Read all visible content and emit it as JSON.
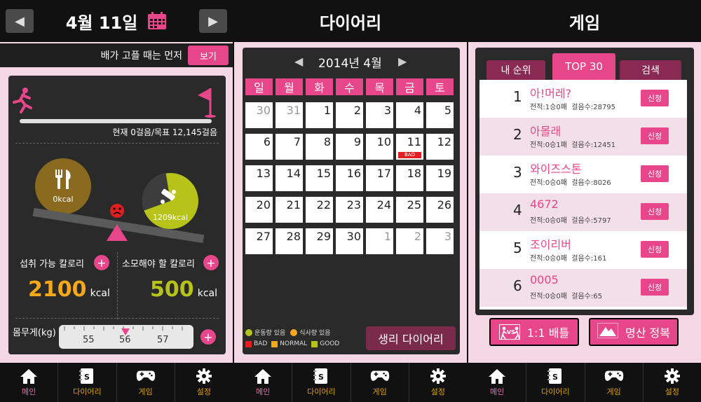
{
  "colors": {
    "accent": "#e8468b",
    "yellow": "#f4a81a",
    "lime": "#b7c318",
    "brown": "#8a6a1e"
  },
  "nav": [
    {
      "label": "메인",
      "icon": "home-icon"
    },
    {
      "label": "다이어리",
      "icon": "diary-icon"
    },
    {
      "label": "게임",
      "icon": "gamepad-icon"
    },
    {
      "label": "설정",
      "icon": "gear-icon"
    }
  ],
  "main": {
    "date": "4월 11일",
    "banner_text": "배가 고플 때는 먼저",
    "banner_button": "보기",
    "steps_text": "현재 0걸음/목표 12,145걸음",
    "intake_kcal": "0kcal",
    "burn_kcal": "1209kcal",
    "burn_fraction": 0.72,
    "intake_label": "섭취 가능 칼로리",
    "burn_label": "소모해야 할 칼로리",
    "intake_value": "2100",
    "burn_value": "500",
    "unit": "kcal",
    "weight_label": "몸무게(kg)",
    "weight_ticks": [
      "55",
      "56",
      "57"
    ]
  },
  "diary": {
    "title": "다이어리",
    "month": "2014년 4월",
    "weekdays": [
      "일",
      "월",
      "화",
      "수",
      "목",
      "금",
      "토"
    ],
    "days": [
      [
        "30",
        "31",
        "1",
        "2",
        "3",
        "4",
        "5"
      ],
      [
        "6",
        "7",
        "8",
        "9",
        "10",
        "11",
        "12"
      ],
      [
        "13",
        "14",
        "15",
        "16",
        "17",
        "18",
        "19"
      ],
      [
        "20",
        "21",
        "22",
        "23",
        "24",
        "25",
        "26"
      ],
      [
        "27",
        "28",
        "29",
        "30",
        "1",
        "2",
        "3"
      ]
    ],
    "bad_badge": "BAD",
    "legend_exercise": "운동량 있음",
    "legend_meal": "식사량 있음",
    "legend_bad": "BAD",
    "legend_normal": "NORMAL",
    "legend_good": "GOOD",
    "period_button": "생리 다이어리"
  },
  "game": {
    "title": "게임",
    "tabs": [
      "내 순위",
      "TOP 30",
      "검색"
    ],
    "rows": [
      {
        "rank": "1",
        "name": "아!머레?",
        "stats": "전적:1승0패  걸음수:28795",
        "button": "신청"
      },
      {
        "rank": "2",
        "name": "아몰래",
        "stats": "전적:0승1패  걸음수:12451",
        "button": "신청"
      },
      {
        "rank": "3",
        "name": "와이즈스톤",
        "stats": "전적:0승0패  걸음수:8026",
        "button": "신청"
      },
      {
        "rank": "4",
        "name": "4672",
        "stats": "전적:0승0패  걸음수:5797",
        "button": "신청"
      },
      {
        "rank": "5",
        "name": "조이리버",
        "stats": "전적:0승0패  걸음수:161",
        "button": "신청"
      },
      {
        "rank": "6",
        "name": "0005",
        "stats": "전적:0승0패  걸음수:65",
        "button": "신청"
      }
    ],
    "battle_button": "1:1 배틀",
    "battle_icon_text": "VS",
    "conquer_button": "명산 정복"
  }
}
